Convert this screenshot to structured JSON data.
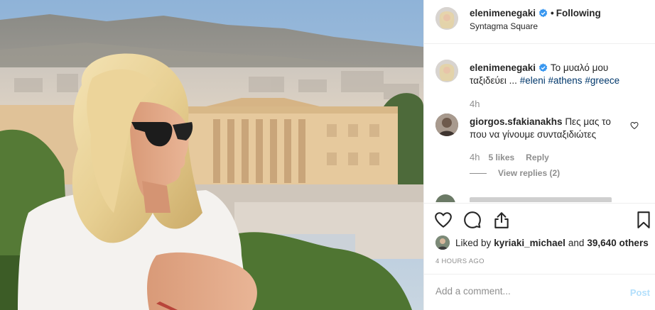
{
  "header": {
    "username": "elenimenegaki",
    "separator": "•",
    "follow_status": "Following",
    "location": "Syntagma Square"
  },
  "caption": {
    "username": "elenimenegaki",
    "text": "Το μυαλό μου ταξιδεύει ...",
    "hashtags": [
      "#eleni",
      "#athens",
      "#greece"
    ],
    "time": "4h"
  },
  "comment": {
    "username": "giorgos.sfakianakhs",
    "text": "Πες μας το που να γίνουμε συνταξιδιώτες",
    "time": "4h",
    "likes": "5 likes",
    "reply_label": "Reply",
    "view_replies": "View replies (2)"
  },
  "likes": {
    "prefix": "Liked by",
    "user": "kyriaki_michael",
    "joiner": "and",
    "others": "39,640 others"
  },
  "timestamp": "4 HOURS AGO",
  "add_comment": {
    "placeholder": "Add a comment...",
    "post_label": "Post"
  },
  "icons": {
    "verified": "verified-badge-icon",
    "like": "heart-icon",
    "comment": "comment-icon",
    "share": "share-icon",
    "save": "bookmark-icon"
  },
  "colors": {
    "verified_blue": "#3897f0",
    "hashtag": "#00376b",
    "muted": "#8e8e8e",
    "post_disabled": "#b2dffc"
  }
}
